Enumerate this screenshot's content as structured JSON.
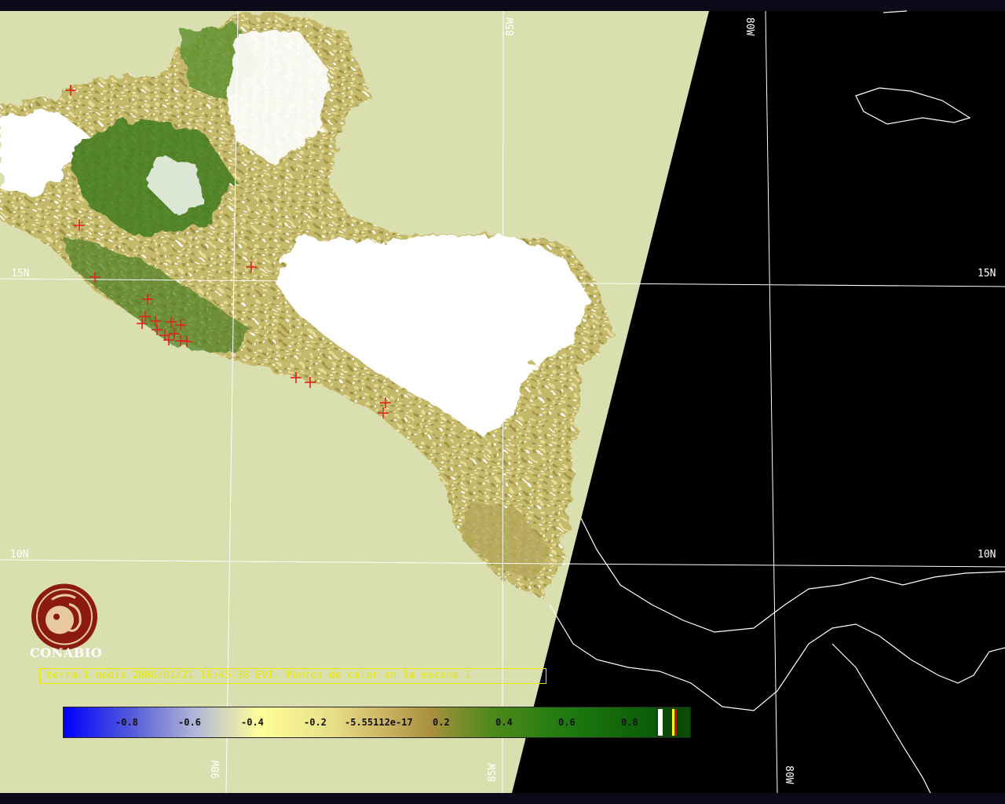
{
  "grid_labels": {
    "lon_85w": "85W",
    "lon_80w": "80W",
    "lon_90w": "90W",
    "lat_15n": "15N",
    "lat_10n": "10N"
  },
  "logo": {
    "name": "CONABIO"
  },
  "caption": "terra-1 modis 2006/01/21 16:45:38 EVI. Puntos de calor en la escena 1",
  "colorbar": {
    "ticks": [
      "-0.8",
      "-0.6",
      "-0.4",
      "-0.2",
      "-5.55112e-17",
      "0.2",
      "0.4",
      "0.6",
      "0.8"
    ]
  },
  "colors": {
    "background": "#000000",
    "ocean": "#dadfaf",
    "coastline": "#ffffff",
    "grid": "#ffffff",
    "hotspot": "#e0241f",
    "caption": "#e8e800",
    "logo": "#8b1a12"
  }
}
